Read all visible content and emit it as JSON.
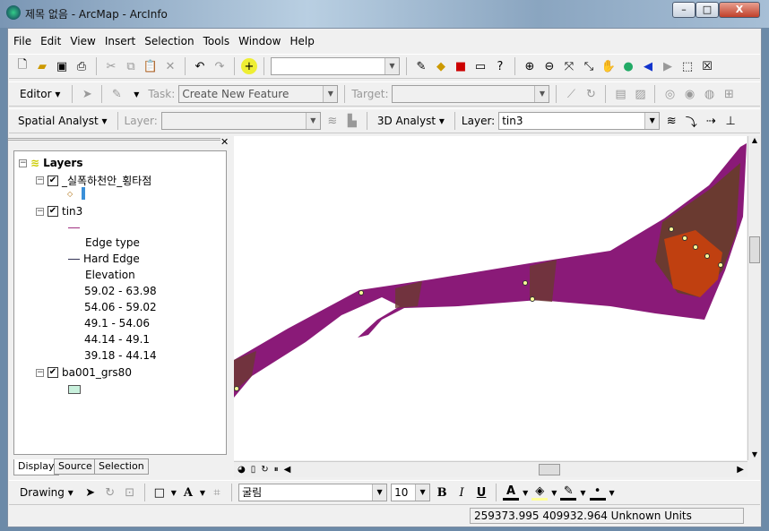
{
  "window": {
    "title": "제목 없음 - ArcMap - ArcInfo",
    "min": "–",
    "max": "□",
    "close": "X"
  },
  "menu": [
    "File",
    "Edit",
    "View",
    "Insert",
    "Selection",
    "Tools",
    "Window",
    "Help"
  ],
  "editor": {
    "label": "Editor ▾",
    "task_label": "Task:",
    "task_value": "Create New Feature",
    "target_label": "Target:"
  },
  "spatial": {
    "label": "Spatial Analyst ▾",
    "layer_label": "Layer:",
    "analyst3d": "3D Analyst ▾",
    "layer3d_label": "Layer:",
    "layer3d_value": "tin3"
  },
  "toc": {
    "root": "Layers",
    "layers": [
      {
        "name": "_실폭하천안_횡타점",
        "checked": true
      },
      {
        "name": "tin3",
        "checked": true,
        "edge_heading": "Edge type",
        "edge_item": "Hard Edge",
        "elev_heading": "Elevation",
        "classes": [
          {
            "label": "59.02 - 63.98",
            "color": "#b0eae4"
          },
          {
            "label": "54.06 - 59.02",
            "color": "#27a03a"
          },
          {
            "label": "49.1 - 54.06",
            "color": "#cc4a10"
          },
          {
            "label": "44.14 - 49.1",
            "color": "#7a4525"
          },
          {
            "label": "39.18 - 44.14",
            "color": "#ffffff"
          }
        ]
      },
      {
        "name": "ba001_grs80",
        "checked": true,
        "color": "#c8f0dc"
      }
    ],
    "tabs": [
      "Display",
      "Source",
      "Selection"
    ]
  },
  "colors": {
    "tin_base": "#8a1a78",
    "tin_dark": "#6a3a30",
    "tin_orange": "#c04010",
    "point": "#ffff99"
  },
  "drawing": {
    "label": "Drawing ▾",
    "font": "굴림",
    "size": "10",
    "bold": "B",
    "italic": "I",
    "underline": "U",
    "text_color": "A"
  },
  "status": {
    "coords": "259373.995  409932.964 Unknown Units"
  }
}
